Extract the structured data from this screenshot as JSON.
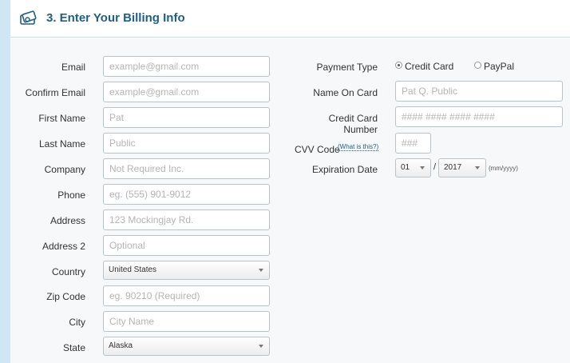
{
  "header": {
    "title": "3. Enter Your Billing Info",
    "icon": "billing-money-icon"
  },
  "left_form": {
    "email": {
      "label": "Email",
      "placeholder": "example@gmail.com"
    },
    "confirm_email": {
      "label": "Confirm Email",
      "placeholder": "example@gmail.com"
    },
    "first_name": {
      "label": "First Name",
      "placeholder": "Pat"
    },
    "last_name": {
      "label": "Last Name",
      "placeholder": "Public"
    },
    "company": {
      "label": "Company",
      "placeholder": "Not Required Inc."
    },
    "phone": {
      "label": "Phone",
      "placeholder": "eg. (555) 901-9012"
    },
    "address": {
      "label": "Address",
      "placeholder": "123 Mockingjay Rd."
    },
    "address2": {
      "label": "Address 2",
      "placeholder": "Optional"
    },
    "country": {
      "label": "Country",
      "value": "United States"
    },
    "zip": {
      "label": "Zip Code",
      "placeholder": "eg. 90210 (Required)"
    },
    "city": {
      "label": "City",
      "placeholder": "City Name"
    },
    "state": {
      "label": "State",
      "value": "Alaska"
    }
  },
  "right_form": {
    "payment_type": {
      "label": "Payment Type",
      "options": [
        "Credit Card",
        "PayPal"
      ],
      "selected": "Credit Card"
    },
    "name_on_card": {
      "label": "Name On Card",
      "placeholder": "Pat Q. Public"
    },
    "card_number": {
      "label": "Credit Card Number",
      "placeholder": "#### #### #### ####"
    },
    "cvv": {
      "label": "CVV Code",
      "help": "(What is this?)",
      "placeholder": "###"
    },
    "expiration": {
      "label": "Expiration Date",
      "month": "01",
      "year": "2017",
      "separator": "/",
      "format_hint": "(mm/yyyy)"
    }
  }
}
